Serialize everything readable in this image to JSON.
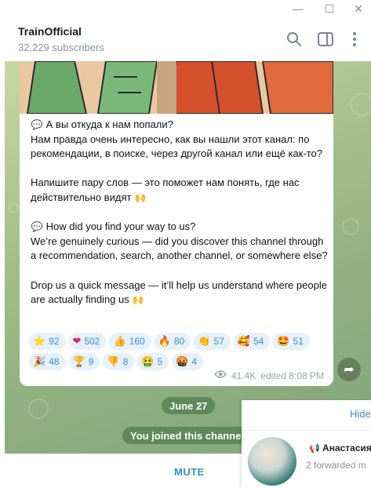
{
  "window": {
    "minimize_glyph": "—",
    "maximize_glyph": "☐",
    "close_glyph": "✕"
  },
  "header": {
    "title": "TrainOfficial",
    "subtitle": "32,229 subscribers",
    "icons": [
      "search-icon",
      "sidebar-toggle-icon",
      "more-icon"
    ]
  },
  "message": {
    "ru_question": "А вы откуда к нам попали?",
    "ru_body": "Нам правда очень интересно, как вы нашли этот канал: по рекомендации, в поиске, через другой канал или ещё как-то?",
    "ru_request": "Напишите пару слов — это поможет нам понять, где нас действительно видят",
    "en_question": "How did you find your way to us?",
    "en_body": "We’re genuinely curious — did you discover this channel through a recommendation, search, another channel, or somewhere else?",
    "en_request": "Drop us a quick message — it’ll help us understand where people are actually finding us",
    "views": "41.4K",
    "edited": "edited 8:08 PM"
  },
  "reactions": [
    {
      "icon": "⭐",
      "count": "92"
    },
    {
      "icon": "❤",
      "count": "502"
    },
    {
      "icon": "👍",
      "count": "160"
    },
    {
      "icon": "🔥",
      "count": "80"
    },
    {
      "icon": "👏",
      "count": "57"
    },
    {
      "icon": "🥰",
      "count": "54"
    },
    {
      "icon": "🤩",
      "count": "51"
    },
    {
      "icon": "🎉",
      "count": "48"
    },
    {
      "icon": "🏆",
      "count": "9"
    },
    {
      "icon": "👎",
      "count": "8"
    },
    {
      "icon": "🤮",
      "count": "5"
    },
    {
      "icon": "🤬",
      "count": "4"
    }
  ],
  "service": {
    "date": "June 27",
    "joined": "You joined this channel"
  },
  "bottom": {
    "mute_label": "MUTE"
  },
  "panel": {
    "hide_label": "Hide",
    "name": "Анастасия",
    "sub": "2 forwarded m"
  },
  "colors": {
    "accent": "#3a8cd0",
    "chat_bg": "#a8c08a"
  }
}
